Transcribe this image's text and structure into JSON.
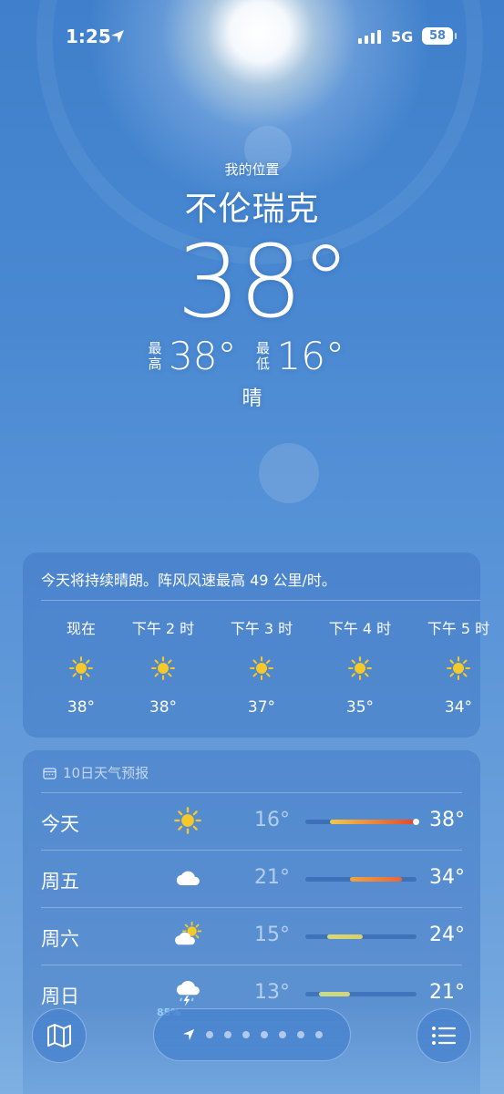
{
  "status_bar": {
    "time": "1:25",
    "network": "5G",
    "battery": "58"
  },
  "header": {
    "location_label": "我的位置",
    "city": "不伦瑞克",
    "temperature": "38°",
    "high_label_1": "最",
    "high_label_2": "高",
    "high_value": "38°",
    "low_label_1": "最",
    "low_label_2": "低",
    "low_value": "16°",
    "condition": "晴"
  },
  "hourly": {
    "summary": "今天将持续晴朗。阵风风速最高 49 公里/时。",
    "items": [
      {
        "label": "现在",
        "icon": "sun-icon",
        "temp": "38°"
      },
      {
        "label": "下午 2 时",
        "icon": "sun-icon",
        "temp": "38°"
      },
      {
        "label": "下午 3 时",
        "icon": "sun-icon",
        "temp": "37°"
      },
      {
        "label": "下午 4 时",
        "icon": "sun-icon",
        "temp": "35°"
      },
      {
        "label": "下午 5 时",
        "icon": "sun-icon",
        "temp": "34°"
      }
    ]
  },
  "daily": {
    "title": "10日天气预报",
    "rows": [
      {
        "day": "今天",
        "icon": "sun-icon",
        "low": "16°",
        "high": "38°",
        "range_start": 0.22,
        "range_end": 0.98,
        "colors": [
          "#f3c84a",
          "#e4492e"
        ],
        "current_dot": true
      },
      {
        "day": "周五",
        "icon": "cloud-icon",
        "low": "21°",
        "high": "34°",
        "range_start": 0.4,
        "range_end": 0.87,
        "colors": [
          "#f0a340",
          "#e8663a"
        ]
      },
      {
        "day": "周六",
        "icon": "partly-cloudy-icon",
        "low": "15°",
        "high": "24°",
        "range_start": 0.2,
        "range_end": 0.52,
        "colors": [
          "#d9d879",
          "#d8cf6a"
        ]
      },
      {
        "day": "周日",
        "icon": "thunderstorm-icon",
        "low": "13°",
        "high": "21°",
        "precip": "85%",
        "range_start": 0.12,
        "range_end": 0.4,
        "colors": [
          "#c6dd8a",
          "#d9d57a"
        ]
      }
    ]
  },
  "colors": {
    "sun": "#f6c928",
    "accent_blue": "#3f7fcb"
  }
}
